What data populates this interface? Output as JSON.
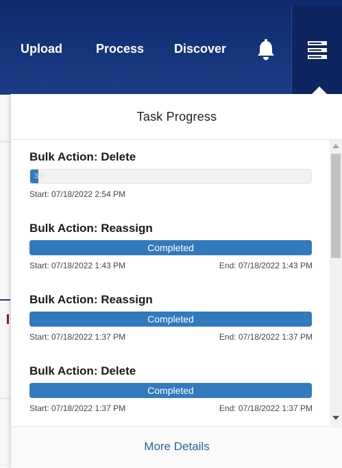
{
  "nav": {
    "items": [
      {
        "label": "Upload"
      },
      {
        "label": "Process"
      },
      {
        "label": "Discover"
      }
    ],
    "notification_icon": "bell-icon",
    "tasks_icon": "task-list-icon"
  },
  "popover": {
    "title": "Task Progress",
    "tasks": [
      {
        "title": "Bulk Action: Delete",
        "progress_percent": 3,
        "progress_label": "3%",
        "start": "Start: 07/18/2022 2:54 PM",
        "end": ""
      },
      {
        "title": "Bulk Action: Reassign",
        "progress_percent": 100,
        "status": "Completed",
        "start": "Start: 07/18/2022 1:43 PM",
        "end": "End: 07/18/2022 1:43 PM"
      },
      {
        "title": "Bulk Action: Reassign",
        "progress_percent": 100,
        "status": "Completed",
        "start": "Start: 07/18/2022 1:37 PM",
        "end": "End: 07/18/2022 1:37 PM"
      },
      {
        "title": "Bulk Action: Delete",
        "progress_percent": 100,
        "status": "Completed",
        "start": "Start: 07/18/2022 1:37 PM",
        "end": "End: 07/18/2022 1:37 PM"
      }
    ],
    "footer_link": "More Details"
  },
  "colors": {
    "nav_bg": "#0f2a6e",
    "progress_blue": "#3279bd",
    "link_blue": "#2c5f9e"
  }
}
